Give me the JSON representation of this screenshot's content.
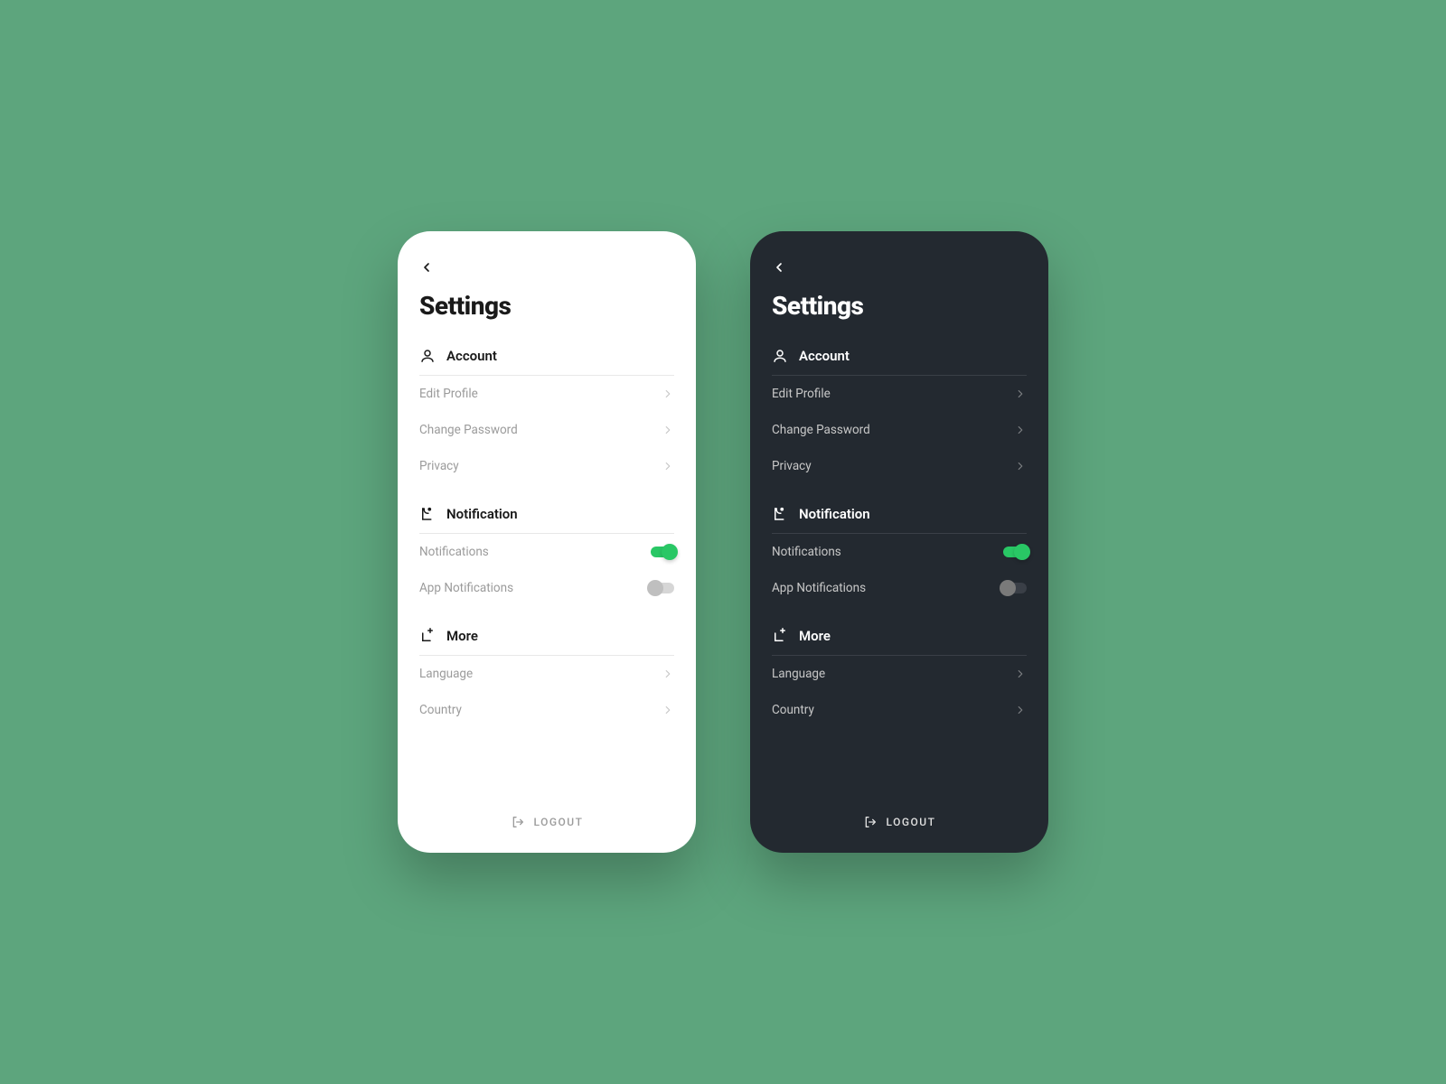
{
  "page_title": "Settings",
  "sections": {
    "account": {
      "label": "Account",
      "items": [
        {
          "label": "Edit Profile"
        },
        {
          "label": "Change Password"
        },
        {
          "label": "Privacy"
        }
      ]
    },
    "notification": {
      "label": "Notification",
      "items": [
        {
          "label": "Notifications",
          "on": true
        },
        {
          "label": "App Notifications",
          "on": false
        }
      ]
    },
    "more": {
      "label": "More",
      "items": [
        {
          "label": "Language"
        },
        {
          "label": "Country"
        }
      ]
    }
  },
  "logout_label": "LOGOUT",
  "colors": {
    "background": "#5da57d",
    "light_bg": "#ffffff",
    "dark_bg": "#232930",
    "accent": "#29c765"
  }
}
